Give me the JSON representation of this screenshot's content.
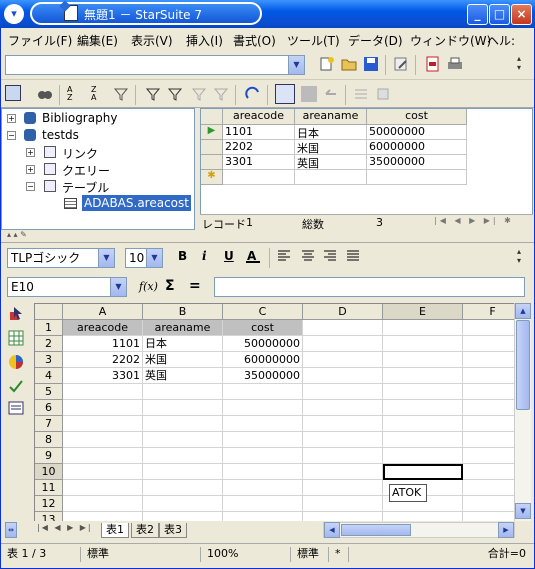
{
  "window": {
    "title": "無題1 － StarSuite 7",
    "minimize": "_",
    "maximize": "□",
    "close": "×"
  },
  "menu": [
    "ファイル(F)",
    "編集(E)",
    "表示(V)",
    "挿入(I)",
    "書式(O)",
    "ツール(T)",
    "データ(D)",
    "ウィンドウ(W)",
    "ヘル:"
  ],
  "datasources": {
    "tree": [
      {
        "label": "Bibliography",
        "toggle": "+"
      },
      {
        "label": "testds",
        "toggle": "−"
      },
      {
        "label": "リンク",
        "toggle": "+"
      },
      {
        "label": "クエリー",
        "toggle": "+"
      },
      {
        "label": "テーブル",
        "toggle": "−"
      },
      {
        "label": "ADABAS.areacost",
        "toggle": ""
      }
    ],
    "columns": [
      "areacode",
      "areaname",
      "cost"
    ],
    "rows": [
      [
        "1101",
        "日本",
        "50000000"
      ],
      [
        "2202",
        "米国",
        "60000000"
      ],
      [
        "3301",
        "英国",
        "35000000"
      ]
    ],
    "record_label": "レコード",
    "record_value": "1",
    "total_label": "総数",
    "total_value": "3"
  },
  "format": {
    "font_name": "TLPゴシック",
    "font_size": "10",
    "bold": "B",
    "italic": "i",
    "underline": "U"
  },
  "formula": {
    "cell_ref": "E10",
    "fx": "f(x)",
    "sigma": "Σ",
    "equals": "=",
    "content": ""
  },
  "sheet": {
    "columns": [
      "A",
      "B",
      "C",
      "D",
      "E",
      "F"
    ],
    "rows": [
      "1",
      "2",
      "3",
      "4",
      "5",
      "6",
      "7",
      "8",
      "9",
      "10",
      "11",
      "12",
      "13"
    ],
    "headers": [
      "areacode",
      "areaname",
      "cost"
    ],
    "data": [
      [
        "1101",
        "日本",
        "50000000"
      ],
      [
        "2202",
        "米国",
        "60000000"
      ],
      [
        "3301",
        "英国",
        "35000000"
      ]
    ],
    "active_cell": "E10",
    "ime_label": "ATOK",
    "tabs": [
      "表1",
      "表2",
      "表3"
    ]
  },
  "status": {
    "sheet": "表 1 / 3",
    "style": "標準",
    "zoom": "100%",
    "mode": "標準",
    "star": "*",
    "sum": "合計=0"
  },
  "colors": {
    "titlebar": "#0a4fd0",
    "chrome": "#ece9d8",
    "header_cell": "#c0c0c0"
  }
}
